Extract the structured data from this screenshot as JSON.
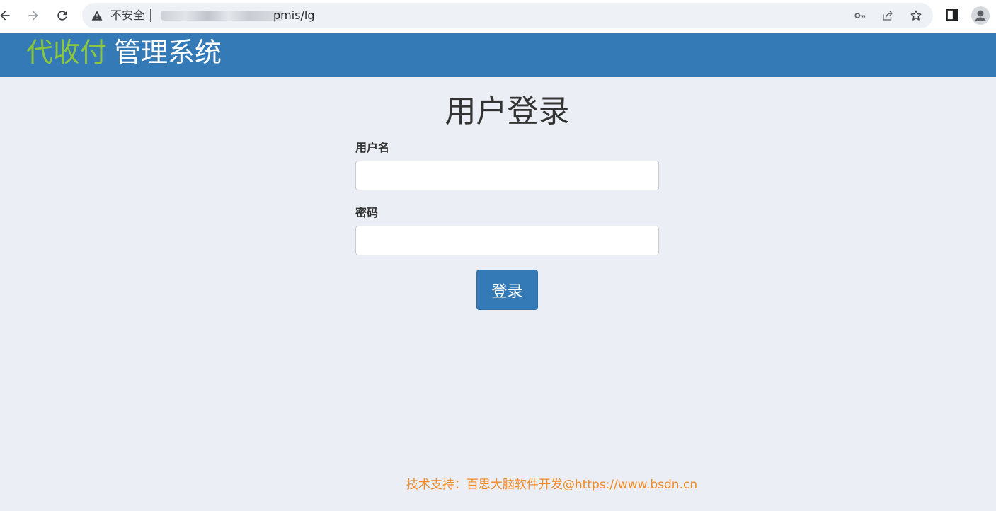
{
  "browser": {
    "insecure_label": "不安全",
    "url_suffix": "pmis/lg",
    "icons": [
      "back-arrow-icon",
      "forward-arrow-icon",
      "reload-icon",
      "warning-icon",
      "key-icon",
      "share-icon",
      "star-icon",
      "side-panel-icon",
      "profile-icon"
    ]
  },
  "header": {
    "brand_accent": "代收付",
    "brand_main": "管理系统",
    "background_color": "#337ab7",
    "accent_color": "#8cc63f"
  },
  "login": {
    "title": "用户登录",
    "username_label": "用户名",
    "username_value": "",
    "password_label": "密码",
    "password_value": "",
    "submit_label": "登录"
  },
  "footer": {
    "text": "技术支持：百思大脑软件开发@https://www.bsdn.cn",
    "color": "#f08a24"
  }
}
